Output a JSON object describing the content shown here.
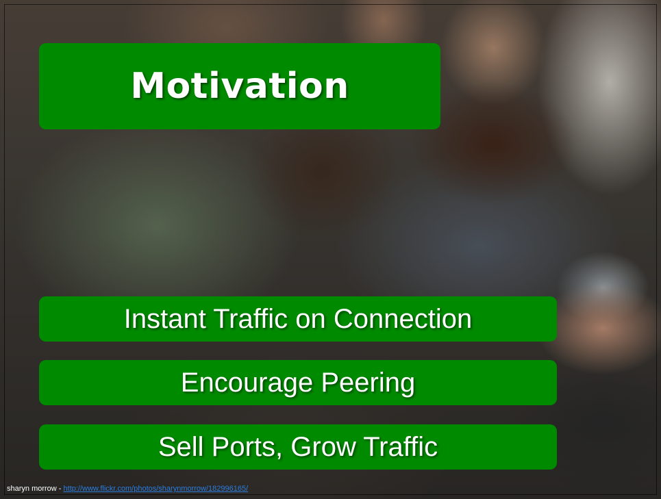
{
  "slide": {
    "title": "Motivation",
    "bullets": [
      {
        "text": "Instant Traffic on Connection"
      },
      {
        "text": "Encourage Peering"
      },
      {
        "text": "Sell Ports, Grow Traffic"
      }
    ],
    "credit": {
      "author": "sharyn morrow - ",
      "url": "http://www.flickr.com/photos/sharynmorrow/182996165/"
    }
  },
  "colors": {
    "box_green": "#008a00",
    "text_white": "#ffffff",
    "link_blue": "#2a7de1"
  }
}
